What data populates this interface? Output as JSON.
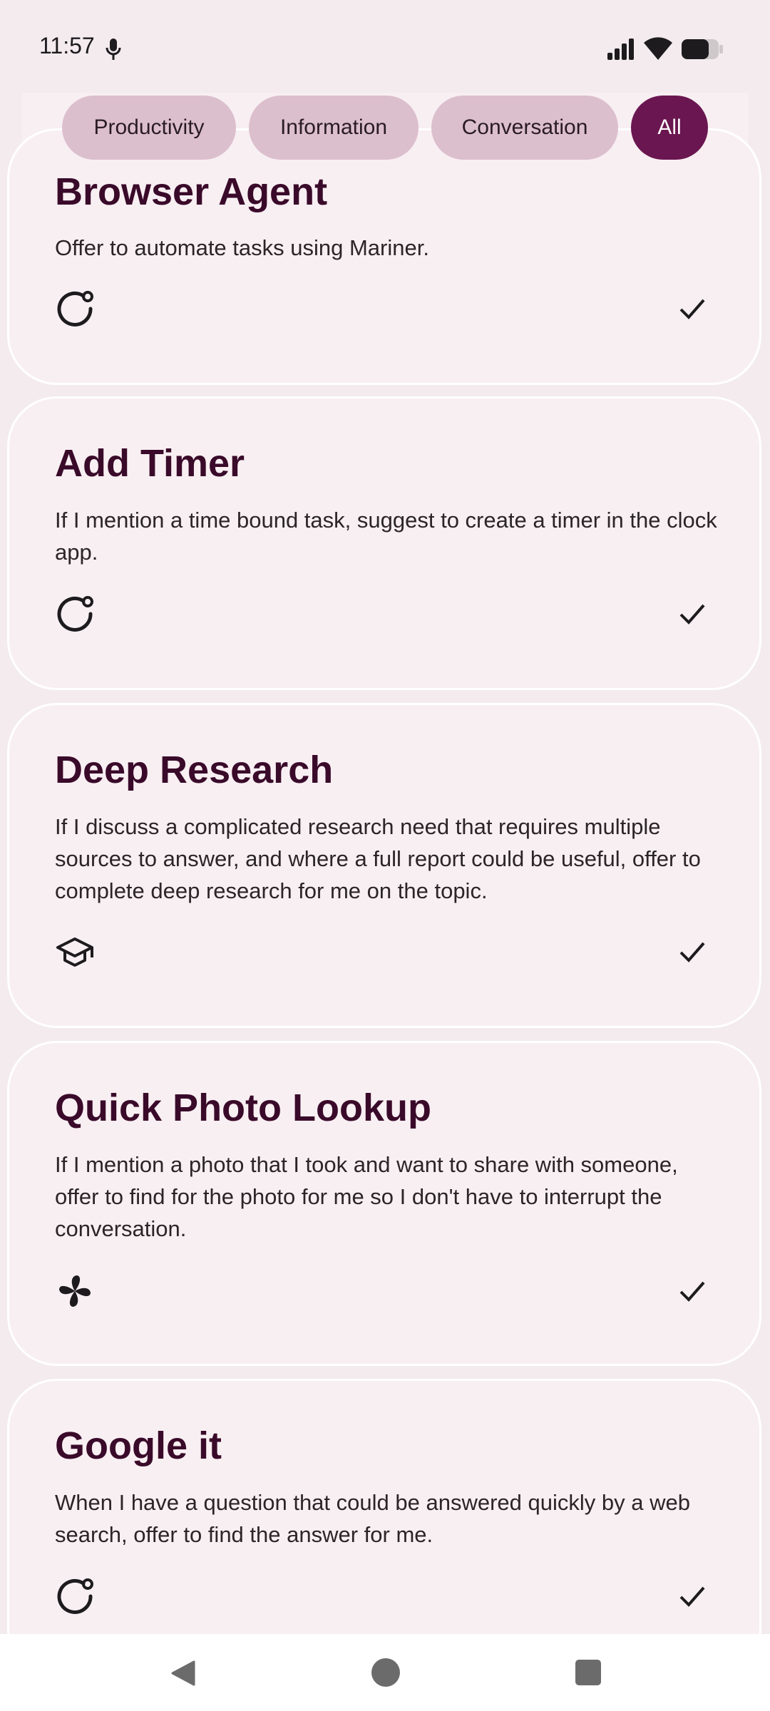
{
  "status_bar": {
    "time": "11:57"
  },
  "filters": [
    {
      "label": "Productivity",
      "active": false
    },
    {
      "label": "Information",
      "active": false
    },
    {
      "label": "Conversation",
      "active": false
    },
    {
      "label": "All",
      "active": true
    }
  ],
  "cards": [
    {
      "title": "Browser Agent",
      "description": "Offer to automate tasks using Mariner.",
      "icon": "refresh-dot-icon",
      "enabled": true
    },
    {
      "title": "Add Timer",
      "description": "If I mention a time bound task, suggest to create a timer in the clock app.",
      "icon": "refresh-dot-icon",
      "enabled": true
    },
    {
      "title": "Deep Research",
      "description": "If I discuss a complicated research need that requires multiple sources to answer, and where a full report could be useful, offer to complete deep research for me on the topic.",
      "icon": "graduation-cap-icon",
      "enabled": true
    },
    {
      "title": "Quick Photo Lookup",
      "description": "If I mention a photo that I took and want to share with someone, offer to find for the photo for me so I don't have to interrupt the conversation.",
      "icon": "pinwheel-icon",
      "enabled": true
    },
    {
      "title": "Google it",
      "description": "When I have a question that could be answered quickly by a web search, offer to find the answer for me.",
      "icon": "refresh-dot-icon",
      "enabled": true
    }
  ]
}
